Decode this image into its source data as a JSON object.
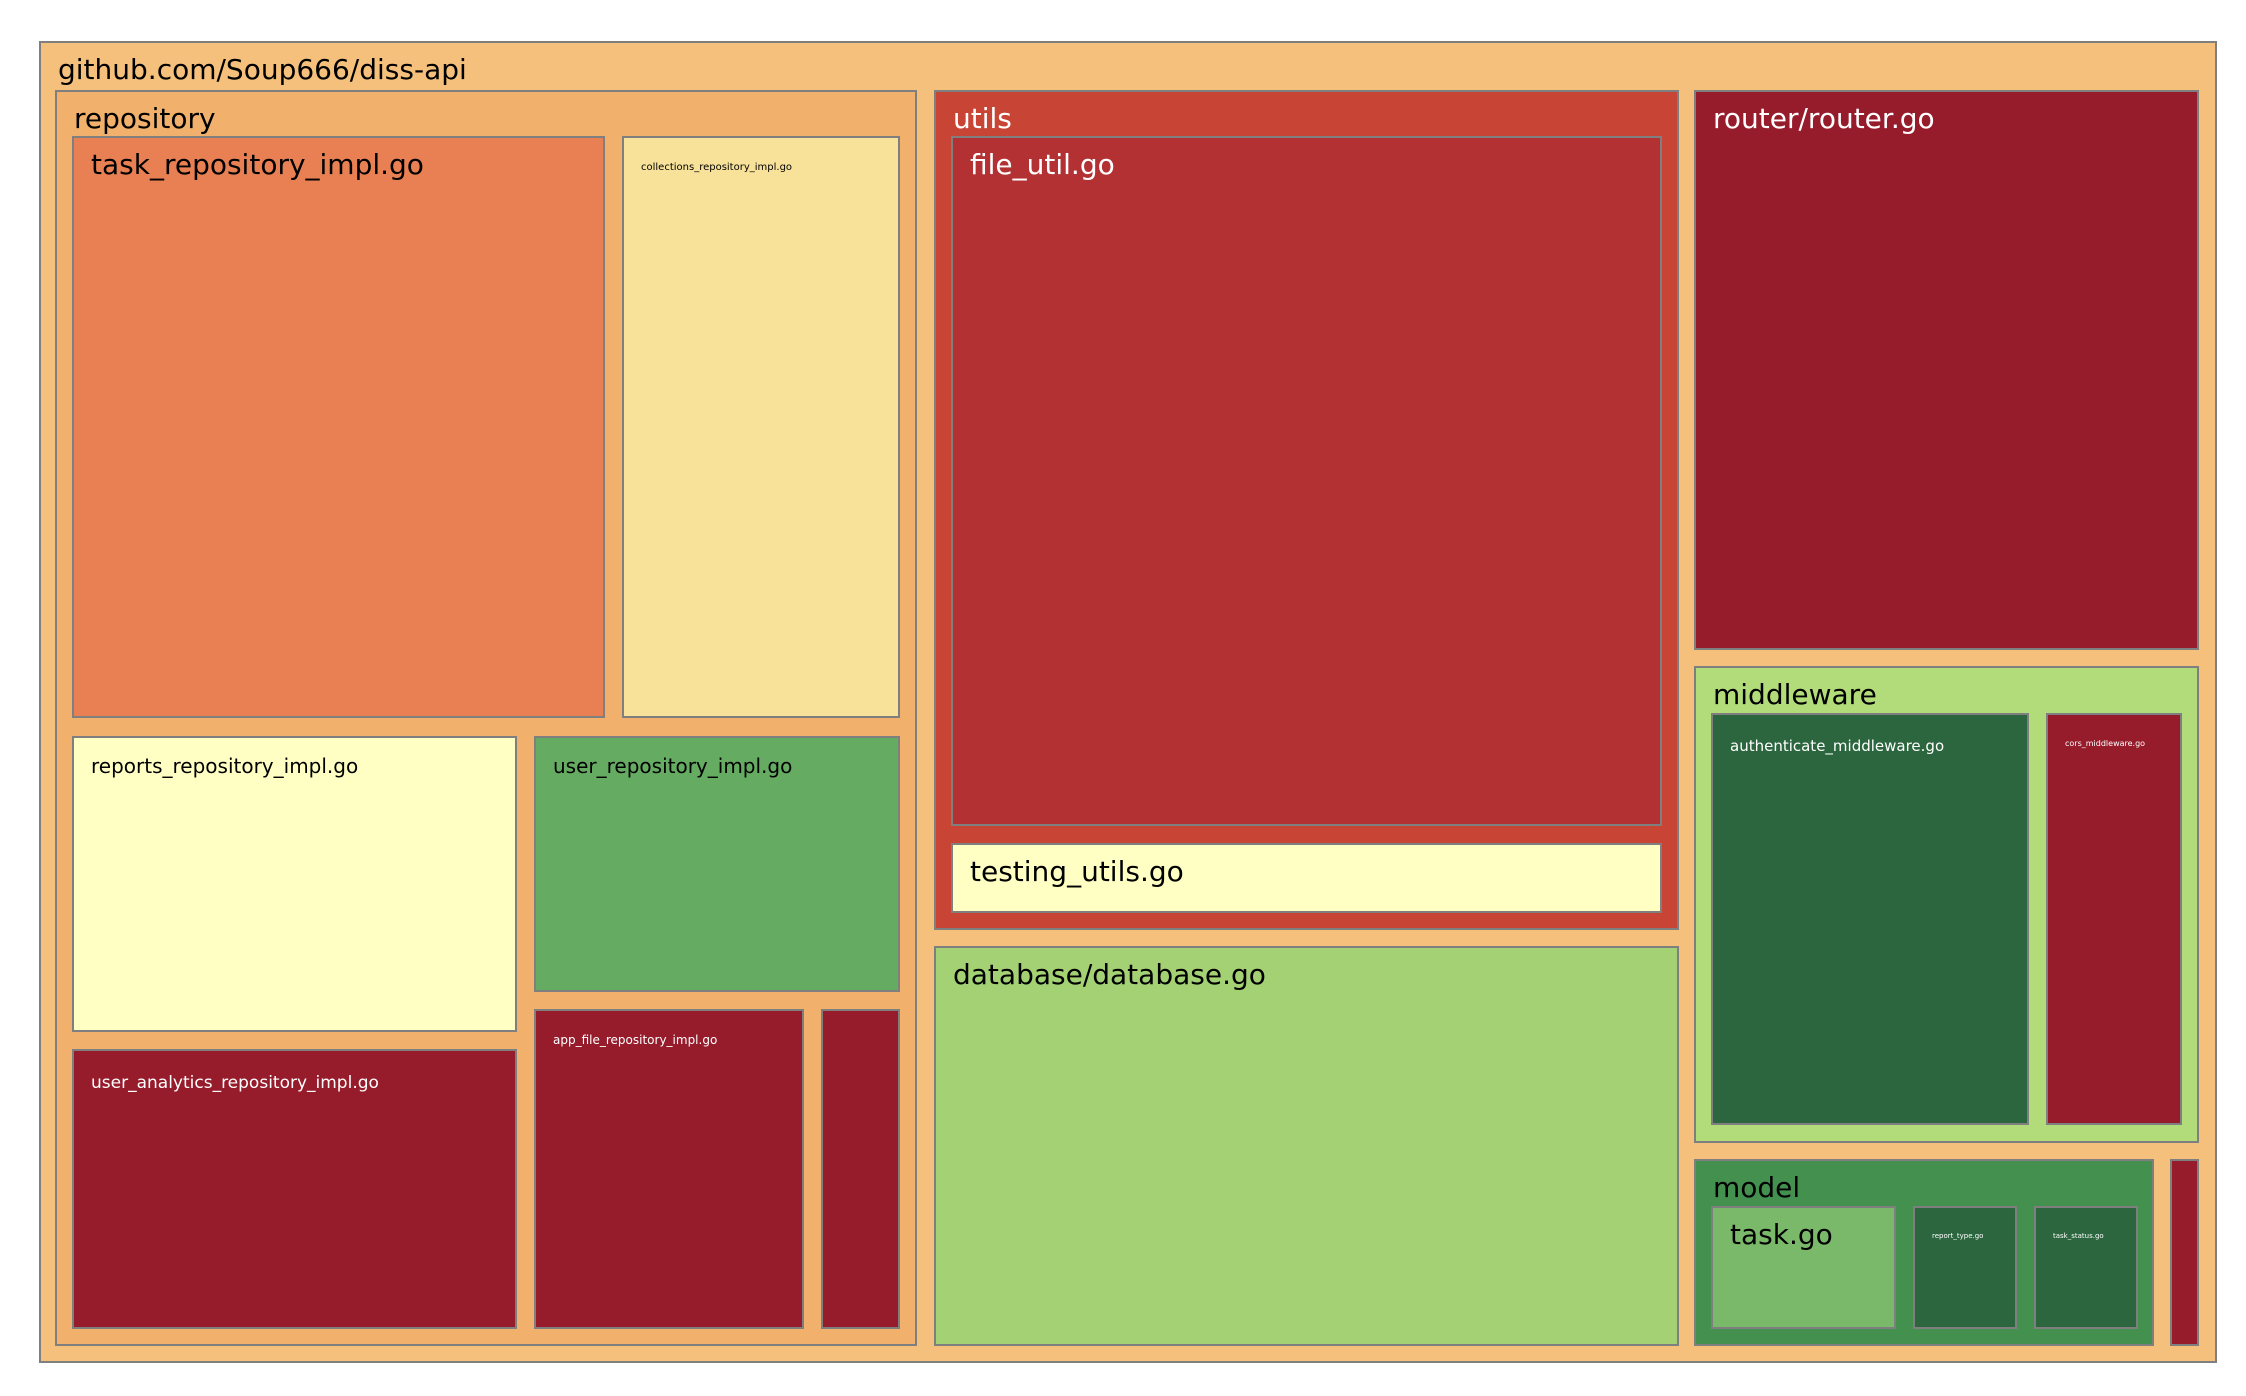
{
  "chart_data": {
    "type": "treemap",
    "root": "github.com/Soup666/diss-api",
    "nodes": [
      {
        "id": "root",
        "label": "github.com/Soup666/diss-api",
        "parent": null,
        "color": "#f4c07c",
        "text_color": "#000000"
      },
      {
        "id": "repository",
        "label": "repository",
        "parent": "root",
        "color": "#f1b06b",
        "text_color": "#000000"
      },
      {
        "id": "task_repository_impl",
        "label": "task_repository_impl.go",
        "parent": "repository",
        "color": "#e88053",
        "text_color": "#000000"
      },
      {
        "id": "collections_repository_impl",
        "label": "collections_repository_impl.go",
        "parent": "repository",
        "color": "#f8e299",
        "text_color": "#000000"
      },
      {
        "id": "reports_repository_impl",
        "label": "reports_repository_impl.go",
        "parent": "repository",
        "color": "#ffffc4",
        "text_color": "#000000"
      },
      {
        "id": "user_repository_impl",
        "label": "user_repository_impl.go",
        "parent": "repository",
        "color": "#65ab62",
        "text_color": "#000000"
      },
      {
        "id": "user_analytics_repository_impl",
        "label": "user_analytics_repository_impl.go",
        "parent": "repository",
        "color": "#961b2b",
        "text_color": "#ffffff"
      },
      {
        "id": "app_file_repository_impl",
        "label": "app_file_repository_impl.go",
        "parent": "repository",
        "color": "#961b2b",
        "text_color": "#ffffff"
      },
      {
        "id": "repository_small",
        "label": "",
        "parent": "repository",
        "color": "#961b2b",
        "text_color": "#ffffff"
      },
      {
        "id": "utils",
        "label": "utils",
        "parent": "root",
        "color": "#c84434",
        "text_color": "#ffffff"
      },
      {
        "id": "file_util",
        "label": "file_util.go",
        "parent": "utils",
        "color": "#b33033",
        "text_color": "#ffffff"
      },
      {
        "id": "testing_utils",
        "label": "testing_utils.go",
        "parent": "utils",
        "color": "#ffffc4",
        "text_color": "#000000"
      },
      {
        "id": "database",
        "label": "database/database.go",
        "parent": "root",
        "color": "#a3d174",
        "text_color": "#000000"
      },
      {
        "id": "router",
        "label": "router/router.go",
        "parent": "root",
        "color": "#961b2b",
        "text_color": "#ffffff"
      },
      {
        "id": "middleware",
        "label": "middleware",
        "parent": "root",
        "color": "#b2dc7a",
        "text_color": "#000000"
      },
      {
        "id": "authenticate_middleware",
        "label": "authenticate_middleware.go",
        "parent": "middleware",
        "color": "#2b663e",
        "text_color": "#ffffff"
      },
      {
        "id": "cors_middleware",
        "label": "cors_middleware.go",
        "parent": "middleware",
        "color": "#961b2b",
        "text_color": "#ffffff"
      },
      {
        "id": "model",
        "label": "model",
        "parent": "root",
        "color": "#44904f",
        "text_color": "#000000"
      },
      {
        "id": "task",
        "label": "task.go",
        "parent": "model",
        "color": "#7bb96a",
        "text_color": "#000000"
      },
      {
        "id": "report_type",
        "label": "report_type.go",
        "parent": "model",
        "color": "#2b663e",
        "text_color": "#ffffff"
      },
      {
        "id": "task_status",
        "label": "task_status.go",
        "parent": "model",
        "color": "#2b663e",
        "text_color": "#ffffff"
      },
      {
        "id": "root_small",
        "label": "",
        "parent": "root",
        "color": "#961b2b",
        "text_color": "#ffffff"
      }
    ]
  }
}
